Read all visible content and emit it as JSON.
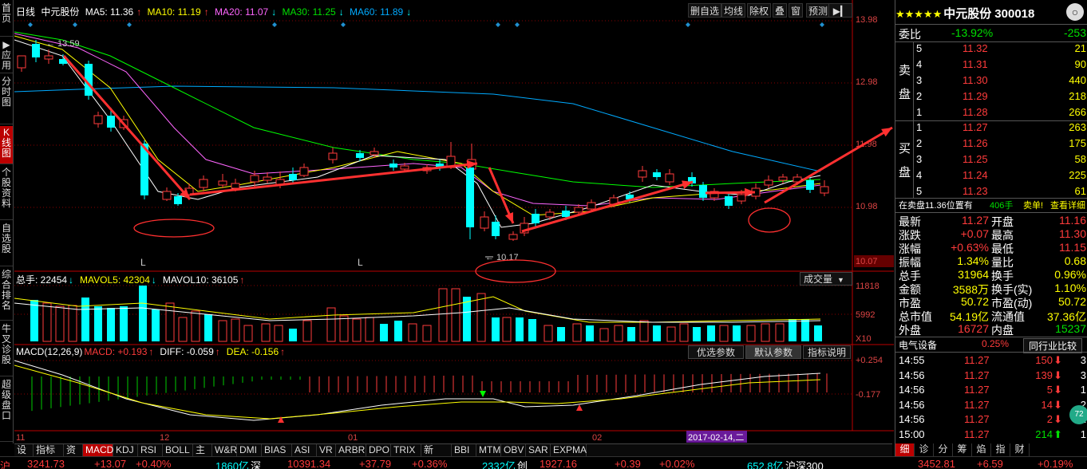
{
  "left_sidebar": {
    "items": [
      {
        "label": "首页"
      },
      {
        "label": "▶应用"
      },
      {
        "label": "分时图"
      },
      {
        "label": "K线图",
        "active": true
      },
      {
        "label": "个股资料"
      },
      {
        "label": "自选股"
      },
      {
        "label": "综合排名"
      },
      {
        "label": "牛叉诊股"
      },
      {
        "label": "超级盘口"
      }
    ]
  },
  "chart_header": {
    "period": "日线",
    "stock": "中元股份",
    "ma5": "MA5: 11.36",
    "ma10": "MA10: 11.19",
    "ma20": "MA20: 11.07",
    "ma30": "MA30: 11.25",
    "ma60": "MA60: 11.89"
  },
  "toolbar": {
    "buttons": [
      "删自选",
      "均线",
      "除权",
      "叠",
      "窗",
      "预测"
    ]
  },
  "price_axis": {
    "labels": [
      "13.98",
      "12.98",
      "11.98",
      "10.98",
      "10.07"
    ],
    "high_marker": "13.59",
    "low_marker": "10.17",
    "l_marks": [
      "L",
      "L"
    ]
  },
  "volume_panel": {
    "total": "总手: 22454",
    "mavol5": "MAVOL5: 42304",
    "mavol10": "MAVOL10: 36105",
    "dropdown": "成交量",
    "axis": [
      "11818",
      "5992",
      "X10"
    ]
  },
  "macd_panel": {
    "title": "MACD(12,26,9)",
    "macd": "MACD: +0.193",
    "diff": "DIFF: -0.059",
    "dea": "DEA: -0.156",
    "buttons": [
      "优选参数",
      "默认参数",
      "指标说明"
    ],
    "axis": [
      "+0.254",
      "-0.177"
    ]
  },
  "x_axis": {
    "labels": [
      "11",
      "12",
      "01",
      "02"
    ],
    "cursor_date": "2017-02-14,二"
  },
  "bottom_tabs": [
    "设置",
    "指标平台",
    "资讯",
    "MACD",
    "KDJ",
    "RSI",
    "BOLL",
    "主力",
    "W&R",
    "DMI",
    "BIAS",
    "ASI",
    "VR",
    "ARBR",
    "DPO",
    "TRIX",
    "新DMA",
    "BBI",
    "MTM",
    "OBV",
    "SAR",
    "EXPMA"
  ],
  "right_panel": {
    "stars": "★★★★★",
    "name": "中元股份",
    "code": "300018",
    "weibi_label": "委比",
    "weibi_value": "-13.92%",
    "weicha_value": "-253",
    "sell_side_label": [
      "卖",
      "盘"
    ],
    "buy_side_label": [
      "买",
      "盘"
    ],
    "sell_orders": [
      {
        "level": "5",
        "price": "11.32",
        "volume": "21"
      },
      {
        "level": "4",
        "price": "11.31",
        "volume": "90"
      },
      {
        "level": "3",
        "price": "11.30",
        "volume": "440"
      },
      {
        "level": "2",
        "price": "11.29",
        "volume": "218"
      },
      {
        "level": "1",
        "price": "11.28",
        "volume": "266"
      }
    ],
    "buy_orders": [
      {
        "level": "1",
        "price": "11.27",
        "volume": "263"
      },
      {
        "level": "2",
        "price": "11.26",
        "volume": "175"
      },
      {
        "level": "3",
        "price": "11.25",
        "volume": "58"
      },
      {
        "level": "4",
        "price": "11.24",
        "volume": "225"
      },
      {
        "level": "5",
        "price": "11.23",
        "volume": "61"
      }
    ],
    "notice": "在卖盘11.36位置有",
    "notice_vol": "406手",
    "notice_action": "卖单!",
    "notice_link": "查看详细",
    "quote_rows": [
      {
        "l1": "最新",
        "v1": "11.27",
        "l2": "开盘",
        "v2": "11.16",
        "c1": "red",
        "c2": "red"
      },
      {
        "l1": "涨跌",
        "v1": "+0.07",
        "l2": "最高",
        "v2": "11.30",
        "c1": "red",
        "c2": "red"
      },
      {
        "l1": "涨幅",
        "v1": "+0.63%",
        "l2": "最低",
        "v2": "11.15",
        "c1": "red",
        "c2": "red"
      },
      {
        "l1": "振幅",
        "v1": "1.34%",
        "l2": "量比",
        "v2": "0.68",
        "c1": "yel",
        "c2": "yel"
      },
      {
        "l1": "总手",
        "v1": "31964",
        "l2": "换手",
        "v2": "0.96%",
        "c1": "yel",
        "c2": "yel"
      },
      {
        "l1": "金额",
        "v1": "3588万",
        "l2": "换手(实)",
        "v2": "1.10%",
        "c1": "yel",
        "c2": "yel"
      },
      {
        "l1": "市盈",
        "v1": "50.72",
        "l2": "市盈(动)",
        "v2": "50.72",
        "c1": "yel",
        "c2": "yel"
      },
      {
        "l1": "总市值",
        "v1": "54.19亿",
        "l2": "流通值",
        "v2": "37.36亿",
        "c1": "yel",
        "c2": "yel"
      },
      {
        "l1": "外盘",
        "v1": "16727",
        "l2": "内盘",
        "v2": "15237",
        "c1": "red",
        "c2": "green"
      }
    ],
    "industry": "电气设备",
    "industry_pct": "0.25%",
    "industry_btn": "同行业比较",
    "ticks": [
      {
        "time": "14:55",
        "price": "11.27",
        "vol": "150",
        "dir": "down",
        "n": "3"
      },
      {
        "time": "14:56",
        "price": "11.27",
        "vol": "139",
        "dir": "down",
        "n": "3"
      },
      {
        "time": "14:56",
        "price": "11.27",
        "vol": "5",
        "dir": "down",
        "n": "1"
      },
      {
        "time": "14:56",
        "price": "11.27",
        "vol": "14",
        "dir": "down",
        "n": "2"
      },
      {
        "time": "14:56",
        "price": "11.27",
        "vol": "2",
        "dir": "down",
        "n": "1"
      },
      {
        "time": "15:00",
        "price": "11.27",
        "vol": "214",
        "dir": "up",
        "n": "1"
      }
    ],
    "bottom_tabs": [
      "细",
      "诊",
      "分",
      "筹",
      "焰",
      "指",
      "财"
    ],
    "badge": "72"
  },
  "status_bar": {
    "items": [
      {
        "text": "沪",
        "c": "red"
      },
      {
        "text": "3241.73",
        "c": "red"
      },
      {
        "text": "+13.07",
        "c": "red"
      },
      {
        "text": "+0.40%",
        "c": "red"
      },
      {
        "text": "1860亿",
        "c": "cyan"
      },
      {
        "text": "深",
        "c": "white"
      },
      {
        "text": "10391.34",
        "c": "red"
      },
      {
        "text": "+37.79",
        "c": "red"
      },
      {
        "text": "+0.36%",
        "c": "red"
      },
      {
        "text": "2332亿",
        "c": "cyan"
      },
      {
        "text": "创",
        "c": "white"
      },
      {
        "text": "1927.16",
        "c": "red"
      },
      {
        "text": "+0.39",
        "c": "red"
      },
      {
        "text": "+0.02%",
        "c": "red"
      },
      {
        "text": "652.8亿",
        "c": "cyan"
      },
      {
        "text": "沪深300",
        "c": "white"
      },
      {
        "text": "3452.81",
        "c": "red"
      },
      {
        "text": "+6.59",
        "c": "red"
      },
      {
        "text": "+0.19%",
        "c": "red"
      }
    ]
  },
  "colors": {
    "up": "#ff3b3b",
    "down": "#00ffff",
    "ma5": "#ffffff",
    "ma10": "#ffff00",
    "ma20": "#ff66ff",
    "ma30": "#00ff00",
    "ma60": "#00aaff",
    "annotation": "#ff3030"
  }
}
